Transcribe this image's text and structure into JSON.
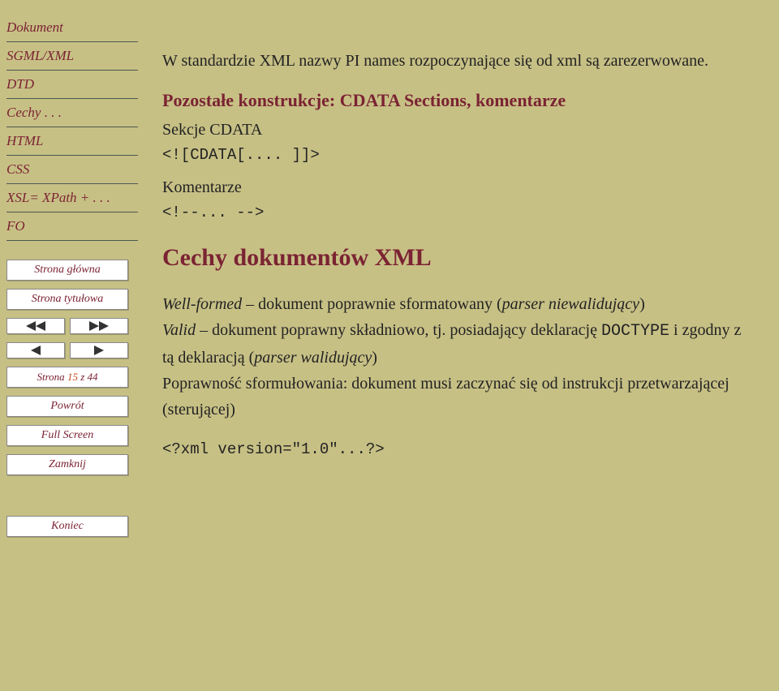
{
  "sidebar": {
    "nav": [
      {
        "label": "Dokument"
      },
      {
        "label": "SGML/XML"
      },
      {
        "label": "DTD"
      },
      {
        "label": "Cechy . . ."
      },
      {
        "label": "HTML"
      },
      {
        "label": "CSS"
      },
      {
        "label": "XSL= XPath + . . ."
      },
      {
        "label": "FO"
      }
    ],
    "buttons": {
      "home": "Strona główna",
      "title_page": "Strona tytułowa",
      "page_prefix": "Strona ",
      "page_current": "15",
      "page_mid": " z ",
      "page_total": "44",
      "back": "Powrót",
      "fullscreen": "Full Screen",
      "close": "Zamknij",
      "end": "Koniec"
    }
  },
  "content": {
    "intro": "W standardzie XML nazwy PI names rozpoczynające się od xml są zarezerwowane.",
    "subheading": "Pozostałe konstrukcje: CDATA Sections, komentarze",
    "section1_label": "Sekcje CDATA",
    "code1": "<![CDATA[.... ]]>",
    "section2_label": "Komentarze",
    "code2": "<!--... -->",
    "heading": "Cechy dokumentów XML",
    "body_wf_em": "Well-formed",
    "body_wf_rest": " – dokument poprawnie sformatowany (",
    "body_wf_em2": "parser niewalidujący",
    "body_wf_close": ")",
    "body_valid_em": "Valid",
    "body_valid_rest": " – dokument poprawny składniowo, tj. posiadający deklarację ",
    "body_doctype": "DOCTYPE",
    "body_valid_rest2": " i zgodny z tą deklaracją (",
    "body_valid_em2": "parser walidujący",
    "body_valid_close": ")",
    "body_poprawnosc": "Poprawność sformułowania: dokument musi zaczynać się od instrukcji przetwarzającej (sterującej)",
    "code3": "<?xml version=\"1.0\"...?>"
  }
}
